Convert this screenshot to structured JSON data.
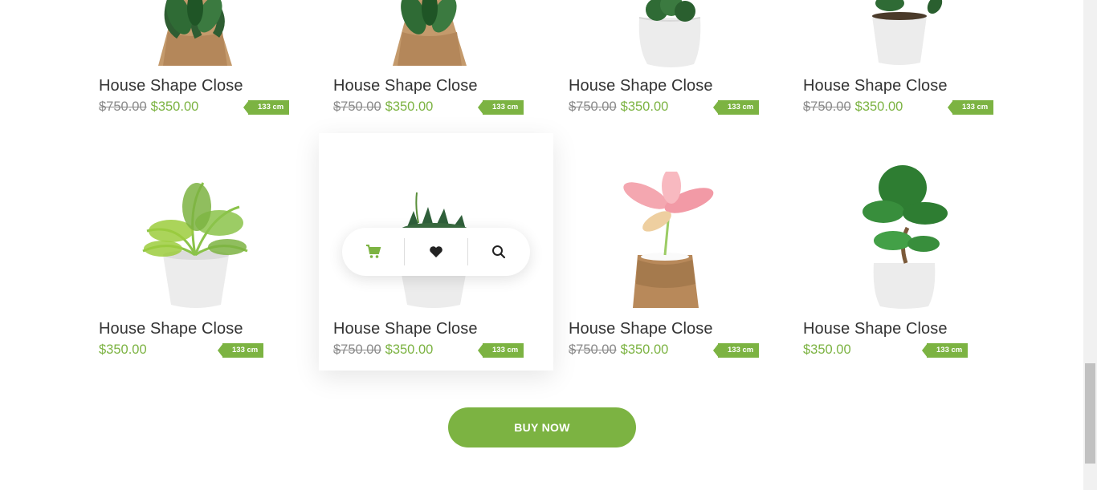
{
  "products": [
    {
      "title": "House Shape Close",
      "old_price": "$750.00",
      "price": "$350.00",
      "tag": "133 cm",
      "plant": "calathea-burlap-icon"
    },
    {
      "title": "House Shape Close",
      "old_price": "$750.00",
      "price": "$350.00",
      "tag": "133 cm",
      "plant": "calathea-burlap-icon"
    },
    {
      "title": "House Shape Close",
      "old_price": "$750.00",
      "price": "$350.00",
      "tag": "133 cm",
      "plant": "bush-white-pot-icon"
    },
    {
      "title": "House Shape Close",
      "old_price": "$750.00",
      "price": "$350.00",
      "tag": "133 cm",
      "plant": "leafy-white-pot-icon"
    },
    {
      "title": "House Shape Close",
      "old_price": "",
      "price": "$350.00",
      "tag": "133 cm",
      "plant": "fern-white-pot-icon"
    },
    {
      "title": "House Shape Close",
      "old_price": "$750.00",
      "price": "$350.00",
      "tag": "133 cm",
      "plant": "succulent-white-pot-icon"
    },
    {
      "title": "House Shape Close",
      "old_price": "$750.00",
      "price": "$350.00",
      "tag": "133 cm",
      "plant": "pink-aglaonema-burlap-icon"
    },
    {
      "title": "House Shape Close",
      "old_price": "",
      "price": "$350.00",
      "tag": "133 cm",
      "plant": "norfolk-pine-white-pot-icon"
    }
  ],
  "hover_actions": {
    "cart": "cart-icon",
    "wishlist": "heart-icon",
    "search": "search-icon"
  },
  "buy_button": {
    "label": "BUY NOW"
  },
  "colors": {
    "accent": "#7cb342",
    "title": "#333333",
    "old_price": "#8a8a8a"
  }
}
